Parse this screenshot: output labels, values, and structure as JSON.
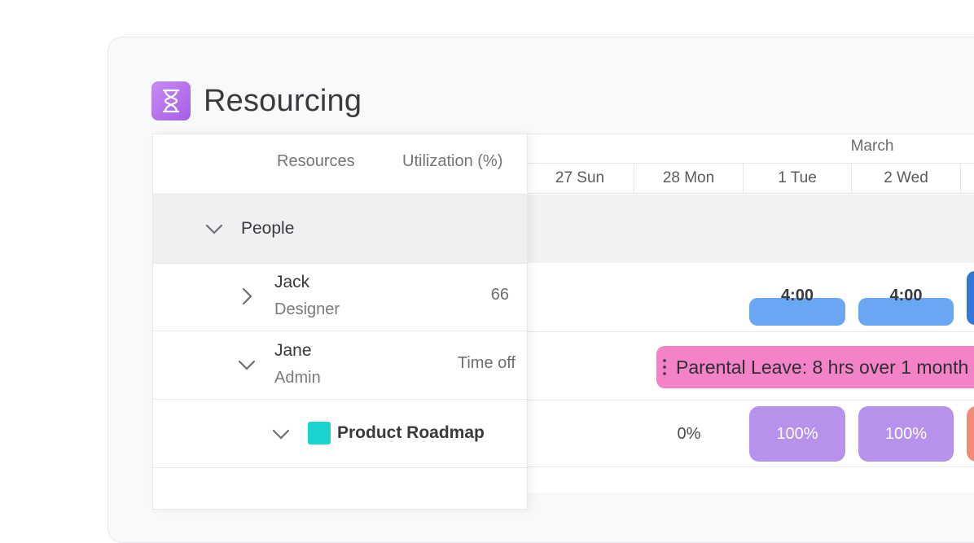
{
  "app": {
    "title": "Resourcing",
    "icon": "hourglass-icon"
  },
  "columns": {
    "resources": "Resources",
    "utilization": "Utilization (%)"
  },
  "group": {
    "label": "People"
  },
  "people": [
    {
      "name": "Jack",
      "role": "Designer",
      "utilization": "66"
    },
    {
      "name": "Jane",
      "role": "Admin",
      "utilization": "Time off"
    }
  ],
  "project": {
    "label": "Product Roadmap",
    "color": "#1ad4cf"
  },
  "timeline": {
    "month": "March",
    "days": [
      "27 Sun",
      "28 Mon",
      "1 Tue",
      "2 Wed"
    ],
    "jack_hours": [
      "4:00",
      "4:00"
    ],
    "leave_label": "Parental Leave: 8 hrs over 1 month",
    "project_values": [
      "0%",
      "100%",
      "100%"
    ]
  },
  "colors": {
    "blue": "#6aa7f3",
    "pink": "#f382c6",
    "purple": "#b692ec",
    "accent": "#a55ee6"
  }
}
